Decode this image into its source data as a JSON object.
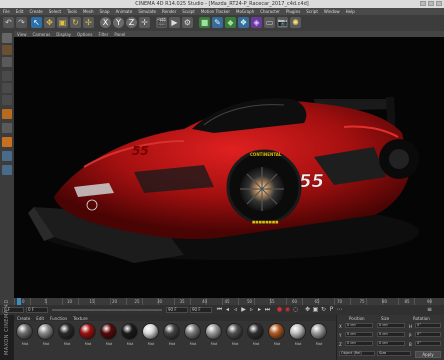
{
  "window": {
    "title": "CINEMA 4D R14.025 Studio - [Mazda_RT24-P_Racecar_2017_c4d.c4d]"
  },
  "menu": [
    "File",
    "Edit",
    "Create",
    "Select",
    "Tools",
    "Mesh",
    "Snap",
    "Animate",
    "Simulate",
    "Render",
    "Sculpt",
    "Motion Tracker",
    "MoGraph",
    "Character",
    "Plugins",
    "Script",
    "Window",
    "Help"
  ],
  "viewport_menu": [
    "View",
    "Cameras",
    "Display",
    "Options",
    "Filter",
    "Panel"
  ],
  "car": {
    "number": "55",
    "tire_brand": "CONTINENTAL",
    "body_color": "#b11414",
    "tire_text_color": "#e6b800"
  },
  "timeline": {
    "labels": [
      "0",
      "5",
      "10",
      "15",
      "20",
      "25",
      "30",
      "35",
      "40",
      "45",
      "50",
      "55",
      "60",
      "65",
      "70",
      "75",
      "80",
      "85",
      "90"
    ],
    "end": "0 F"
  },
  "transport": {
    "frame_start": "0 F",
    "frame_current": "0 F",
    "frame_end": "90 F",
    "frame_max": "90 F"
  },
  "materials": {
    "tabs": [
      "Create",
      "Edit",
      "Function",
      "Texture"
    ],
    "items": [
      {
        "name": "Mat",
        "color": "#6e6e6e"
      },
      {
        "name": "Mat",
        "color": "#8a8a8a"
      },
      {
        "name": "Mat",
        "color": "#2a2a2a"
      },
      {
        "name": "Mat",
        "color": "#a01010"
      },
      {
        "name": "Mat",
        "color": "#5a0808"
      },
      {
        "name": "Mat",
        "color": "#1a1a1a"
      },
      {
        "name": "Mat",
        "color": "#d8d8d8"
      },
      {
        "name": "Mat",
        "color": "#444444"
      },
      {
        "name": "Mat",
        "color": "#777777"
      },
      {
        "name": "Mat",
        "color": "#999999"
      },
      {
        "name": "Mat",
        "color": "#505050"
      },
      {
        "name": "Mat",
        "color": "#303030"
      },
      {
        "name": "Mat",
        "color": "#b05a20"
      },
      {
        "name": "Mat",
        "color": "#c0c0c0"
      },
      {
        "name": "Mat",
        "color": "#9a9a9a"
      }
    ]
  },
  "brand": "MAXON CINEMA 4D",
  "coords": {
    "headers": [
      "Position",
      "Size",
      "Rotation"
    ],
    "rows": [
      {
        "axis": "X",
        "pos": "0 cm",
        "size": "0 cm",
        "rot_axis": "H",
        "rot": "0°"
      },
      {
        "axis": "Y",
        "pos": "0 cm",
        "size": "0 cm",
        "rot_axis": "P",
        "rot": "0°"
      },
      {
        "axis": "Z",
        "pos": "0 cm",
        "size": "0 cm",
        "rot_axis": "B",
        "rot": "0°"
      }
    ],
    "mode": "Object (Rel)",
    "size_mode": "Size",
    "apply": "Apply"
  }
}
